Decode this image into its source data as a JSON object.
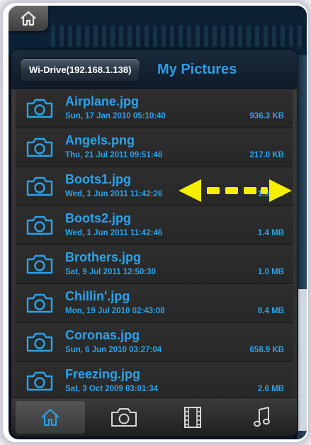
{
  "header": {
    "back_label": "Wi-Drive(192.168.1.138)",
    "title": "My Pictures"
  },
  "files": [
    {
      "name": "Airplane.jpg",
      "date": "Sun, 17 Jan 2010 05:10:40",
      "size": "936.3 KB"
    },
    {
      "name": "Angels.png",
      "date": "Thu, 21 Jul 2011 09:51:46",
      "size": "217.0 KB"
    },
    {
      "name": "Boots1.jpg",
      "date": "Wed, 1 Jun 2011 11:42:26",
      "size": "1.8 MB"
    },
    {
      "name": "Boots2.jpg",
      "date": "Wed, 1 Jun 2011 11:42:46",
      "size": "1.4 MB"
    },
    {
      "name": "Brothers.jpg",
      "date": "Sat, 9 Jul 2011 12:50:30",
      "size": "1.0 MB"
    },
    {
      "name": "Chillin'.jpg",
      "date": "Mon, 19 Jul 2010 02:43:08",
      "size": "8.4 MB"
    },
    {
      "name": "Coronas.jpg",
      "date": "Sun, 6 Jun 2010 03:27:04",
      "size": "658.9 KB"
    },
    {
      "name": "Freezing.jpg",
      "date": "Sat, 3 Oct 2009 03:01:34",
      "size": "2.6 MB"
    }
  ],
  "tabbar": {
    "tabs": [
      {
        "icon": "home-icon",
        "selected": true
      },
      {
        "icon": "camera-icon",
        "selected": false
      },
      {
        "icon": "film-icon",
        "selected": false
      },
      {
        "icon": "music-note-icon",
        "selected": false
      }
    ]
  },
  "colors": {
    "accent": "#2aa3ec",
    "title": "#2e9de6",
    "swipe_arrow": "#f5f000"
  }
}
